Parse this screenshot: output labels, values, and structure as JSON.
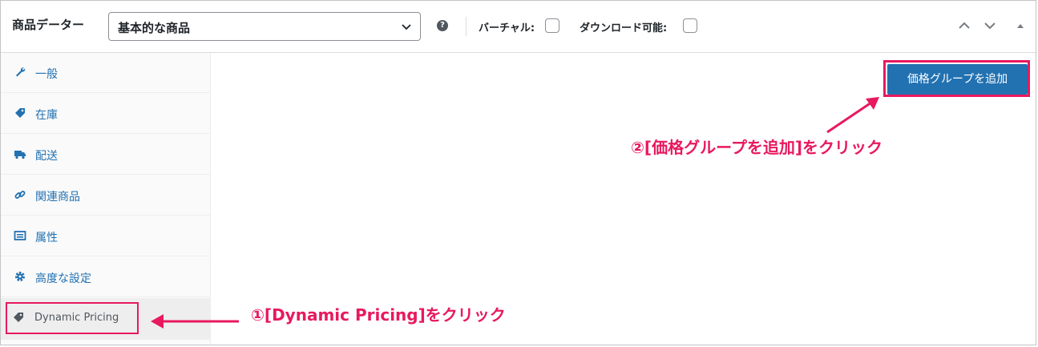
{
  "header": {
    "title": "商品データー",
    "product_type": "基本的な商品",
    "help_icon": "?",
    "virtual_label": "バーチャル:",
    "downloadable_label": "ダウンロード可能:"
  },
  "sidebar": {
    "items": [
      {
        "label": "一般",
        "icon": "wrench-icon"
      },
      {
        "label": "在庫",
        "icon": "tag-icon"
      },
      {
        "label": "配送",
        "icon": "truck-icon"
      },
      {
        "label": "関連商品",
        "icon": "link-icon"
      },
      {
        "label": "属性",
        "icon": "list-icon"
      },
      {
        "label": "高度な設定",
        "icon": "gear-icon"
      },
      {
        "label": "Dynamic Pricing",
        "icon": "tag-icon",
        "active": true
      }
    ]
  },
  "main": {
    "add_group_button": "価格グループを追加"
  },
  "annotations": {
    "step1": "①[Dynamic Pricing]をクリック",
    "step2": "②[価格グループを追加]をクリック"
  },
  "colors": {
    "accent": "#2271b1",
    "annotation": "#e8195f"
  }
}
